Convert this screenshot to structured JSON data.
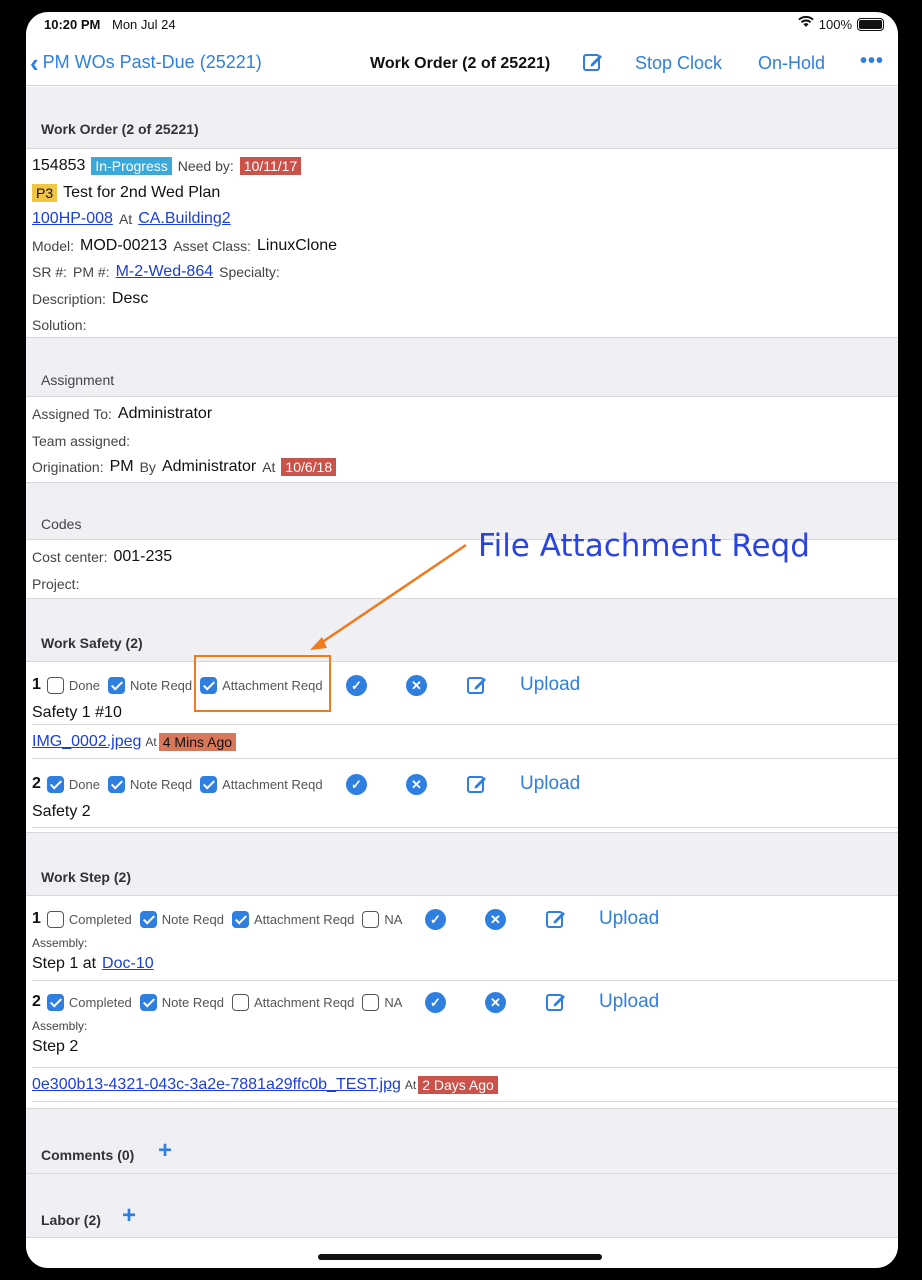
{
  "status": {
    "time": "10:20 PM",
    "date": "Mon Jul 24",
    "battery": "100%"
  },
  "nav": {
    "back_label": "PM WOs Past-Due (25221)",
    "title": "Work Order (2 of 25221)",
    "stop_clock": "Stop Clock",
    "on_hold": "On-Hold",
    "more": "•••"
  },
  "work_order": {
    "header": "Work Order (2 of 25221)",
    "id": "154853",
    "status": "In-Progress",
    "need_by_label": "Need by:",
    "need_by": "10/11/17",
    "priority": "P3",
    "title": "Test for 2nd Wed Plan",
    "asset": "100HP-008",
    "at_label": "At",
    "location": "CA.Building2",
    "model_label": "Model:",
    "model": "MOD-00213",
    "asset_class_label": "Asset Class:",
    "asset_class": "LinuxClone",
    "sr_label": "SR #:",
    "pm_label": "PM #:",
    "pm": "M-2-Wed-864",
    "specialty_label": "Specialty:",
    "description_label": "Description:",
    "description": "Desc",
    "solution_label": "Solution:"
  },
  "assignment": {
    "header": "Assignment",
    "assigned_to_label": "Assigned To:",
    "assigned_to": "Administrator",
    "team_label": "Team assigned:",
    "origination_label": "Origination:",
    "origination": "PM",
    "by_label": "By",
    "by": "Administrator",
    "at_label": "At",
    "at": "10/6/18"
  },
  "codes": {
    "header": "Codes",
    "cost_center_label": "Cost center:",
    "cost_center": "001-235",
    "project_label": "Project:"
  },
  "work_safety": {
    "header": "Work Safety (2)",
    "items": [
      {
        "num": "1",
        "done": false,
        "note_reqd": true,
        "attach_reqd": true,
        "name": "Safety 1 #10",
        "file": "IMG_0002.jpeg",
        "file_at": "At",
        "file_time": "4 Mins Ago"
      },
      {
        "num": "2",
        "done": true,
        "note_reqd": true,
        "attach_reqd": true,
        "name": "Safety 2"
      }
    ],
    "done_label": "Done",
    "note_label": "Note Reqd",
    "attach_label": "Attachment Reqd",
    "upload_label": "Upload"
  },
  "work_step": {
    "header": "Work Step (2)",
    "completed_label": "Completed",
    "note_label": "Note Reqd",
    "attach_label": "Attachment Reqd",
    "na_label": "NA",
    "upload_label": "Upload",
    "assembly_label": "Assembly:",
    "items": [
      {
        "num": "1",
        "completed": false,
        "note_reqd": true,
        "attach_reqd": true,
        "na": false,
        "step": "Step 1 at",
        "doc": "Doc-10"
      },
      {
        "num": "2",
        "completed": true,
        "note_reqd": true,
        "attach_reqd": false,
        "na": false,
        "step": "Step 2",
        "file": "0e300b13-4321-043c-3a2e-7881a29ffc0b_TEST.jpg",
        "file_at": "At",
        "file_time": "2 Days Ago"
      }
    ]
  },
  "comments": {
    "header": "Comments (0)"
  },
  "labor": {
    "header": "Labor (2)"
  },
  "annotation": {
    "text": "File Attachment Reqd"
  },
  "colors": {
    "accent": "#2f7fe0",
    "link": "#1a3fd6",
    "annotation_box": "#f07a1c",
    "annotation_text": "#2a44e0"
  }
}
